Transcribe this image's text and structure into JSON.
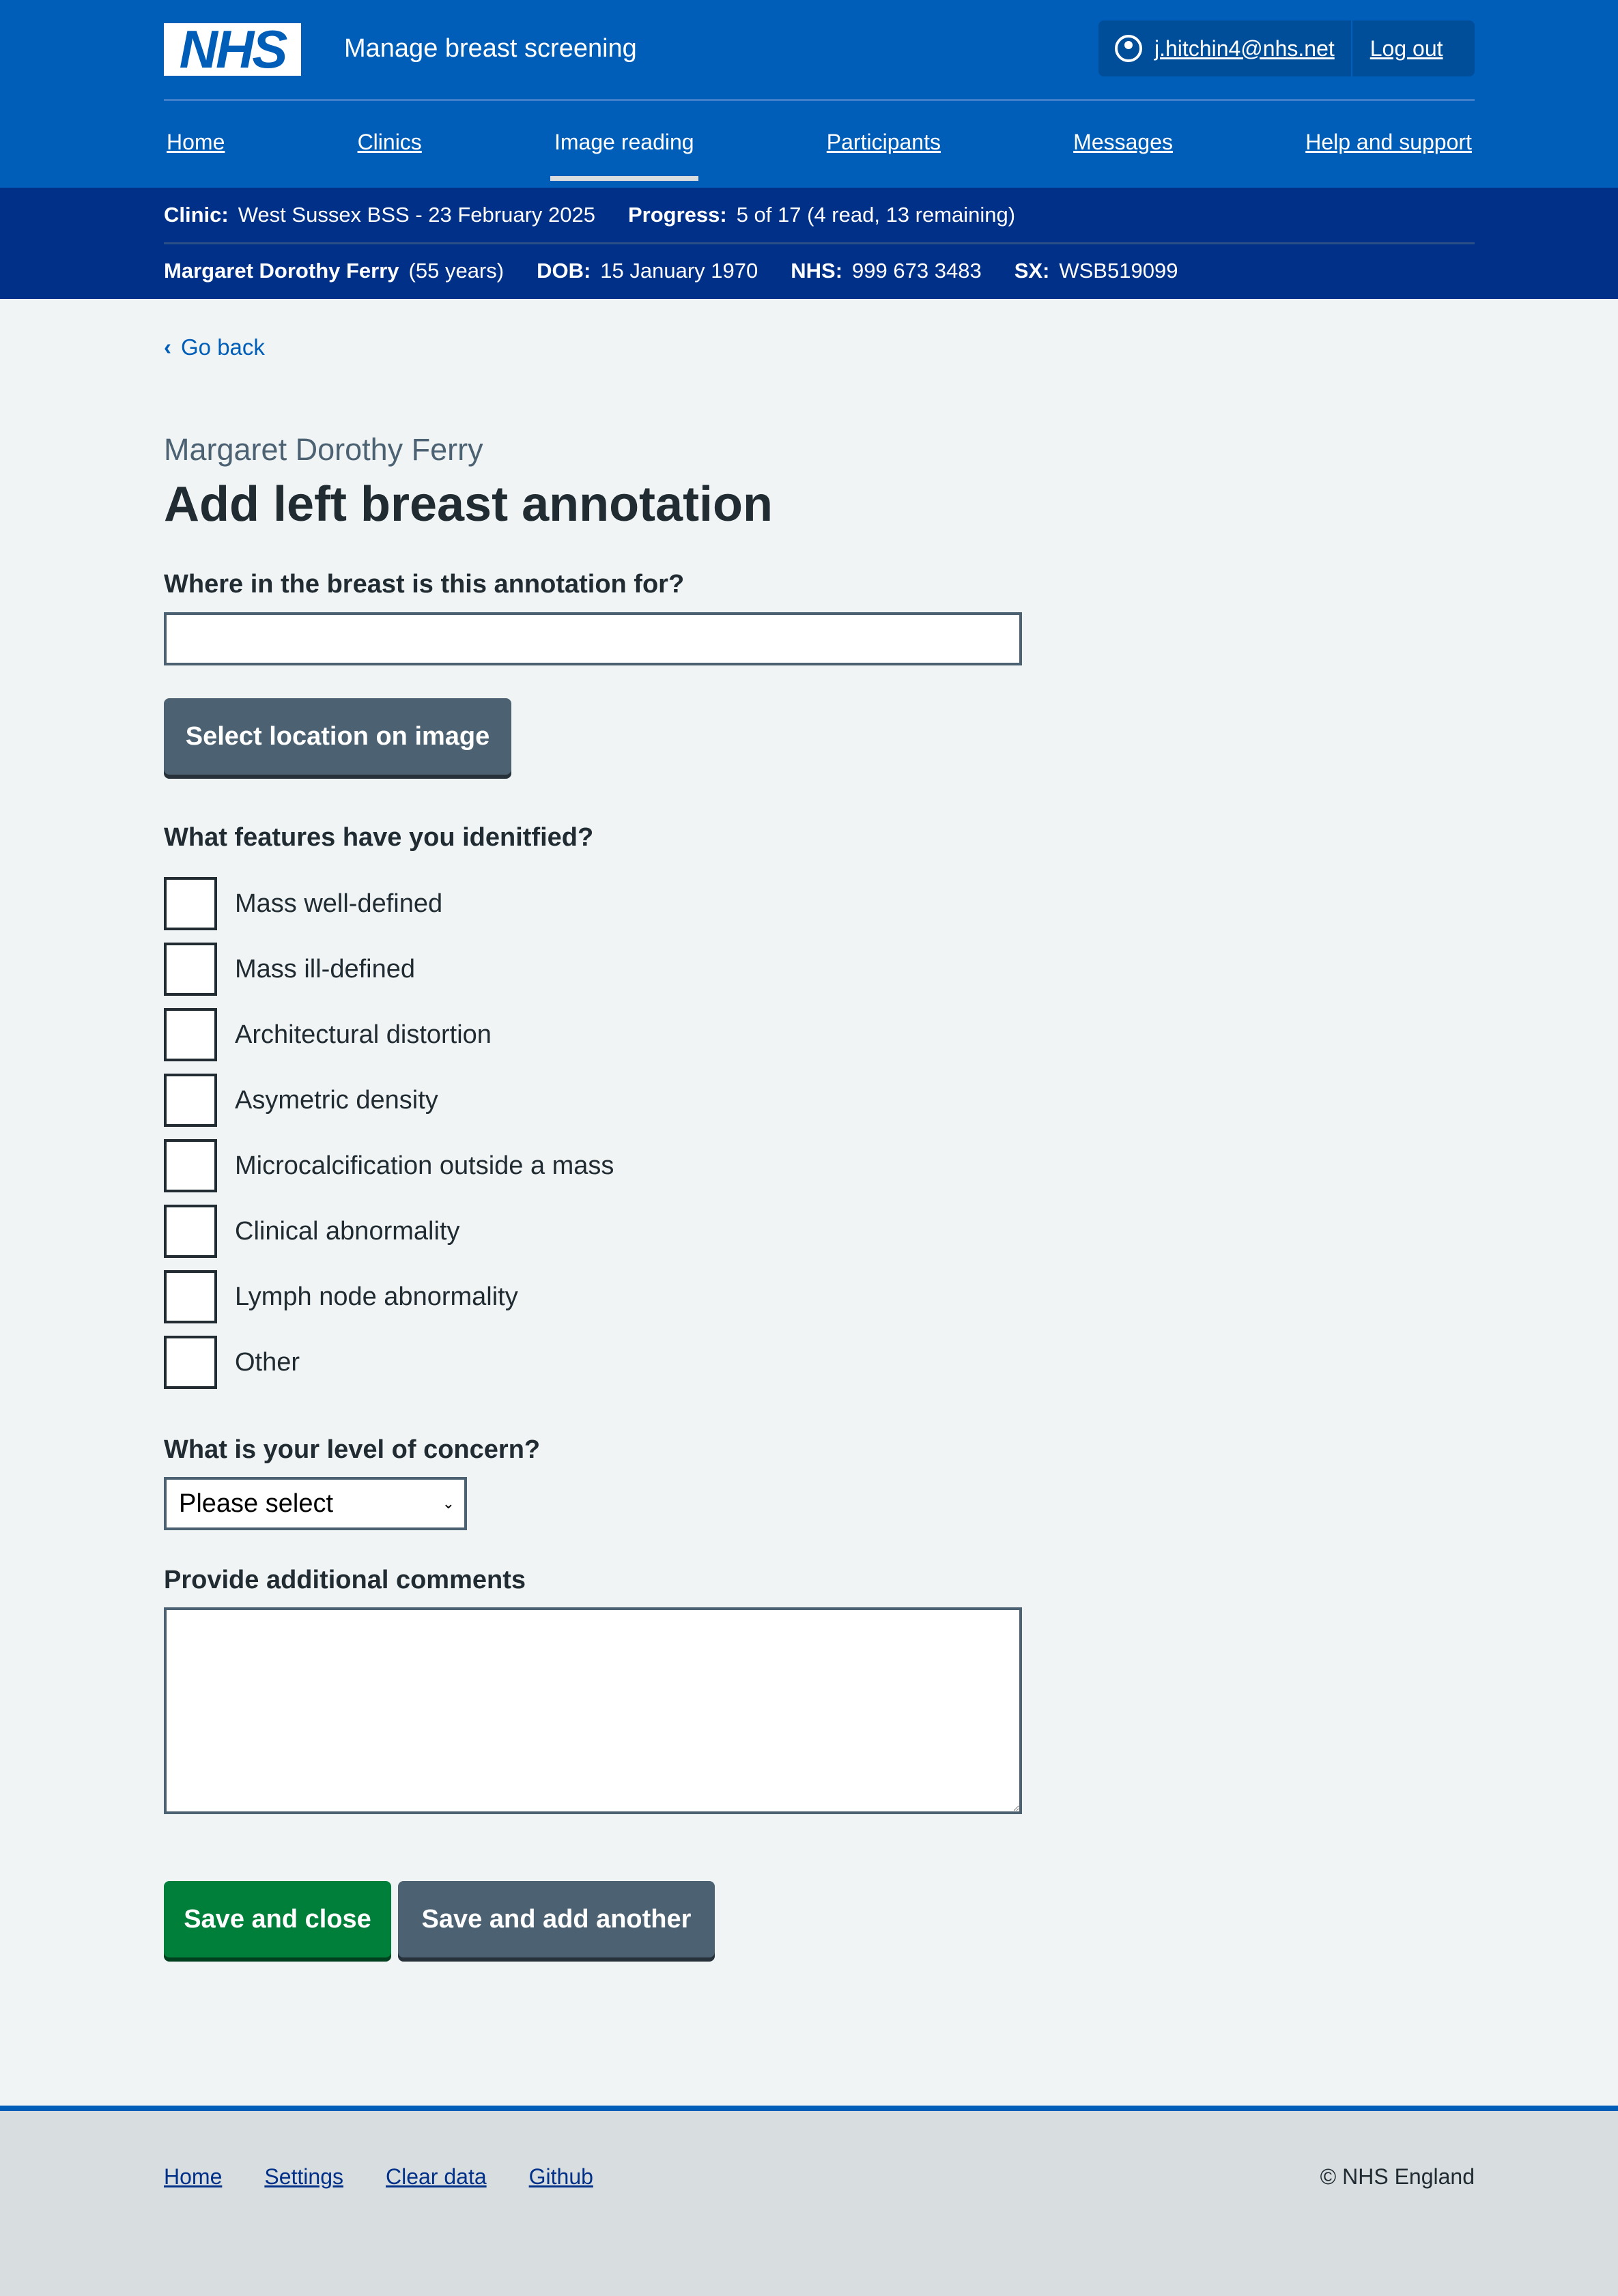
{
  "header": {
    "logo": "NHS",
    "service": "Manage breast screening",
    "user": "j.hitchin4@nhs.net",
    "logout": "Log out"
  },
  "nav": [
    {
      "label": "Home"
    },
    {
      "label": "Clinics"
    },
    {
      "label": "Image reading",
      "current": true
    },
    {
      "label": "Participants"
    },
    {
      "label": "Messages"
    },
    {
      "label": "Help and support"
    }
  ],
  "context": {
    "clinic_label": "Clinic:",
    "clinic": "West Sussex BSS - 23 February 2025",
    "progress_label": "Progress:",
    "progress": "5 of 17 (4 read, 13 remaining)",
    "name": "Margaret Dorothy Ferry",
    "age": "(55 years)",
    "dob_label": "DOB:",
    "dob": "15 January 1970",
    "nhs_label": "NHS:",
    "nhs": "999 673 3483",
    "sx_label": "SX:",
    "sx": "WSB519099"
  },
  "back": "Go back",
  "caption": "Margaret Dorothy Ferry",
  "title": "Add left breast annotation",
  "form": {
    "location_label": "Where in the breast is this annotation for?",
    "location_value": "",
    "select_location": "Select location on image",
    "features_label": "What features have you idenitfied?",
    "features": [
      "Mass well-defined",
      "Mass ill-defined",
      "Architectural distortion",
      "Asymetric density",
      "Microcalcification outside a mass",
      "Clinical abnormality",
      "Lymph node abnormality",
      "Other"
    ],
    "concern_label": "What is your level of concern?",
    "concern_value": "Please select",
    "comments_label": "Provide additional comments",
    "comments_value": "",
    "save_close": "Save and close",
    "save_another": "Save and add another"
  },
  "footer": {
    "links": [
      "Home",
      "Settings",
      "Clear data",
      "Github"
    ],
    "copyright": "© NHS England"
  },
  "colors": {
    "brand": "#005eb8",
    "dark": "#003087",
    "primary_button": "#007f3b",
    "secondary_button": "#4c6272"
  }
}
